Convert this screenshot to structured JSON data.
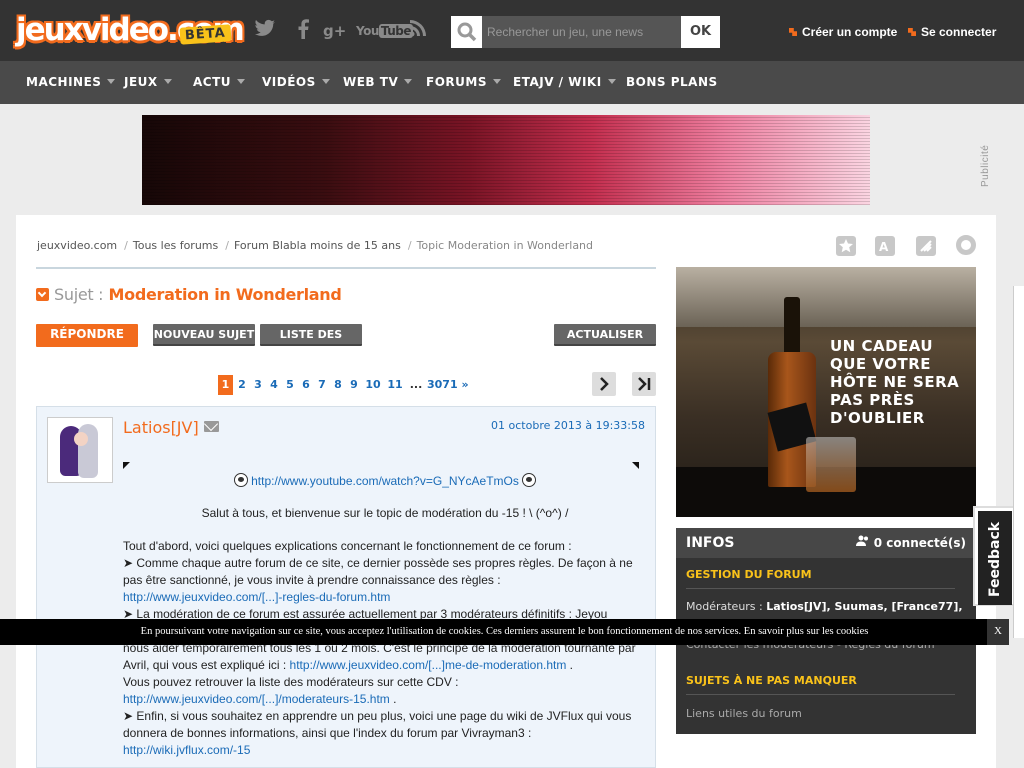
{
  "header": {
    "logo": "jeuxvideo.com",
    "badge": "BÊTA",
    "social": [
      "twitter",
      "facebook",
      "g+",
      "YouTube",
      "rss"
    ],
    "search_placeholder": "Rechercher un jeu, une news",
    "search_button": "OK",
    "create_account": "Créer un compte",
    "login": "Se connecter"
  },
  "nav": {
    "items": [
      {
        "label": "MACHINES",
        "caret": true
      },
      {
        "label": "JEUX",
        "caret": true
      },
      {
        "label": "ACTU",
        "caret": true
      },
      {
        "label": "VIDÉOS",
        "caret": true
      },
      {
        "label": "WEB TV",
        "caret": true
      },
      {
        "label": "FORUMS",
        "caret": true
      },
      {
        "label": "ETAJV / WIKI",
        "caret": true
      },
      {
        "label": "BONS PLANS",
        "caret": false
      }
    ]
  },
  "ad": {
    "publicite": "Publicité"
  },
  "breadcrumb": [
    "jeuxvideo.com",
    "Tous les forums",
    "Forum Blabla moins de 15 ans",
    "Topic Moderation in Wonderland"
  ],
  "subject": {
    "label": "Sujet :",
    "title": "Moderation in Wonderland"
  },
  "buttons": {
    "reply": "RÉPONDRE",
    "new_topic": "NOUVEAU SUJET",
    "topic_list": "LISTE DES SUJETS",
    "refresh": "ACTUALISER"
  },
  "pagination": {
    "pages": [
      "1",
      "2",
      "3",
      "4",
      "5",
      "6",
      "7",
      "8",
      "9",
      "10",
      "11"
    ],
    "ellipsis": "...",
    "last": "3071",
    "next": "»",
    "current": "1"
  },
  "post": {
    "author": "Latios[JV]",
    "date": "01 octobre 2013 à 19:33:58",
    "youtube_link": "http://www.youtube.com/watch?v=G_NYcAeTmOs",
    "greeting": "Salut à tous, et bienvenue sur le topic de modération du -15 ! \\ (^o^) /",
    "intro": "Tout d'abord, voici quelques explications concernant le fonctionnement de ce forum :",
    "p1": "➤ Comme chaque autre forum de ce site, ce dernier possède ses propres règles. De façon à ne pas être sanctionné, je vous invite à prendre connaissance des règles :",
    "p1_link": "http://www.jeuxvideo.com/[...]-regles-du-forum.htm",
    "p2a": "➤ La modération de ce forum est assurée actuellement par 3 modérateurs définitifs : Jeyou",
    "p2b": "nous aider temporairement tous les 1 ou 2 mois. C'est le principe de la modération tournante par Avril, qui vous est expliqué ici :",
    "p2_link": "http://www.jeuxvideo.com/[...]me-de-moderation.htm",
    "p2_end": ".",
    "p3": "Vous pouvez retrouver la liste des modérateurs sur cette CDV :",
    "p3_link": "http://www.jeuxvideo.com/[...]/moderateurs-15.htm",
    "p3_end": ".",
    "p4": "➤ Enfin, si vous souhaitez en apprendre un peu plus, voici une page du wiki de JVFlux qui vous donnera de bonnes informations, ainsi que l'index du forum par Vivrayman3 :",
    "p4_link": "http://wiki.jvflux.com/-15"
  },
  "sidebar_ad": {
    "tagline": "UN CADEAU QUE VOTRE HÔTE NE SERA PAS PRÈS D'OUBLIER"
  },
  "infos": {
    "title": "INFOS",
    "connected": "0 connecté(s)",
    "section1": "GESTION DU FORUM",
    "moderators_label": "Modérateurs :",
    "moderators": "Latios[JV], Suumas, [France77],",
    "contact": "Contacter les modérateurs - Règles du forum",
    "section2": "SUJETS À NE PAS MANQUER",
    "links": "Liens utiles du forum"
  },
  "feedback": "Feedback",
  "cookie": {
    "text": "En poursuivant votre navigation sur ce site, vous acceptez l'utilisation de cookies. Ces derniers assurent le bon fonctionnement de nos services. En savoir plus sur les cookies",
    "close": "X"
  }
}
